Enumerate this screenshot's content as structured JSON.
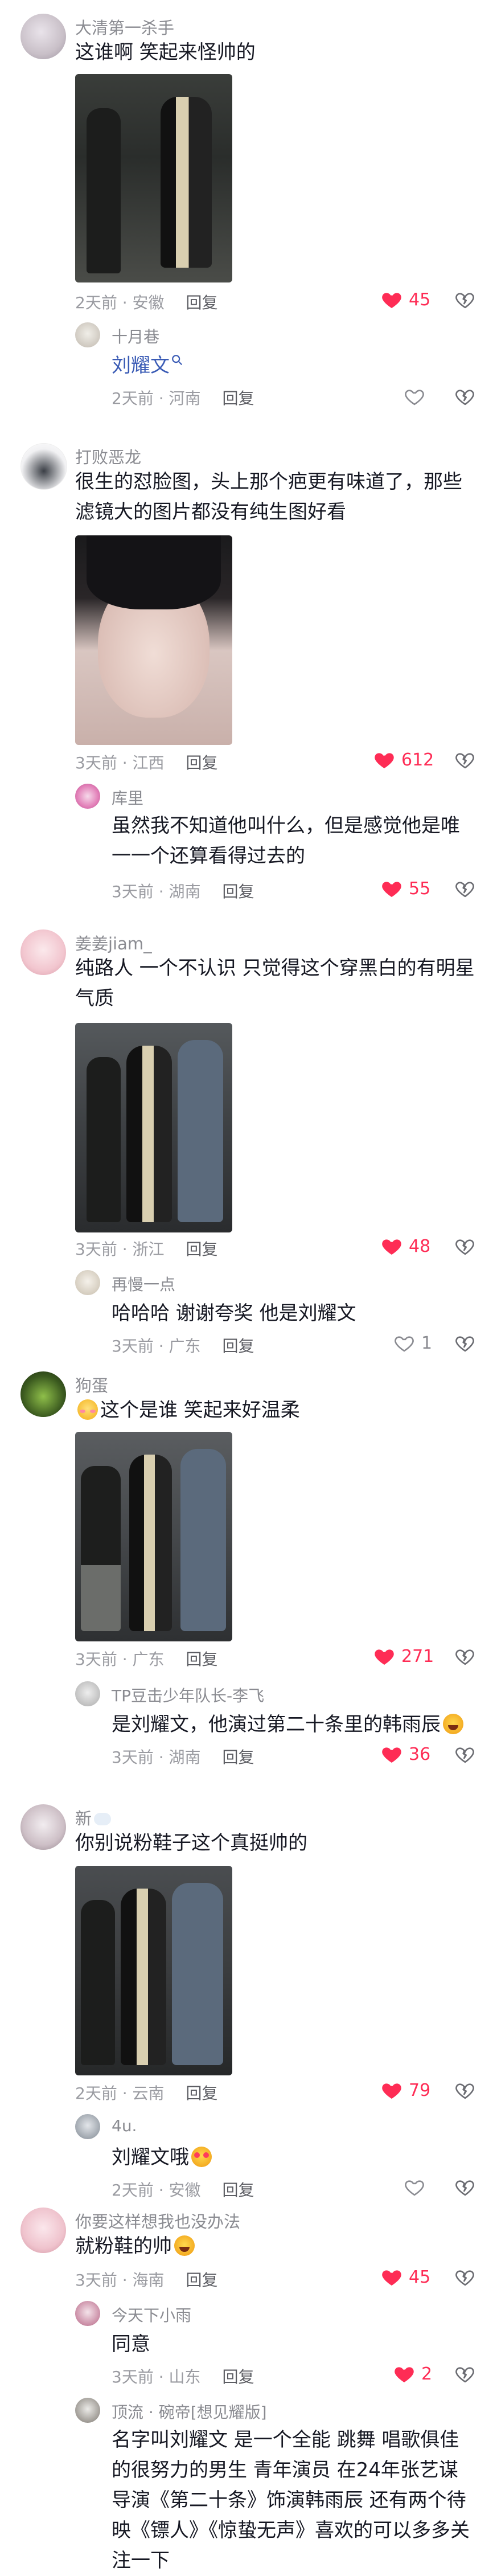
{
  "comments": [
    {
      "user": "大清第一杀手",
      "text": "这谁啊 笑起来怪帅的",
      "time": "2天前 · 安徽",
      "reply_label": "回复",
      "likes": "45",
      "replies": [
        {
          "user": "十月巷",
          "text": "刘耀文",
          "time": "2天前 · 河南",
          "reply_label": "回复",
          "likes": ""
        }
      ]
    },
    {
      "user": "打败恶龙",
      "text": "很生的怼脸图，头上那个疤更有味道了，那些滤镜大的图片都没有纯生图好看",
      "time": "3天前 · 江西",
      "reply_label": "回复",
      "likes": "612",
      "replies": [
        {
          "user": "库里",
          "text": "虽然我不知道他叫什么，但是感觉他是唯一一个还算看得过去的",
          "time": "3天前 · 湖南",
          "reply_label": "回复",
          "likes": "55"
        }
      ]
    },
    {
      "user": "姜姜jiam_",
      "text": "纯路人 一个不认识 只觉得这个穿黑白的有明星气质",
      "time": "3天前 · 浙江",
      "reply_label": "回复",
      "likes": "48",
      "replies": [
        {
          "user": "再慢一点",
          "text": "哈哈哈 谢谢夸奖 他是刘耀文",
          "time": "3天前 · 广东",
          "reply_label": "回复",
          "likes": "1"
        }
      ]
    },
    {
      "user": "狗蛋",
      "text": "这个是谁 笑起来好温柔",
      "time": "3天前 · 广东",
      "reply_label": "回复",
      "likes": "271",
      "replies": [
        {
          "user": "TP豆击少年队长-李飞",
          "text": "是刘耀文，他演过第二十条里的韩雨辰",
          "time": "3天前 · 湖南",
          "reply_label": "回复",
          "likes": "36"
        }
      ]
    },
    {
      "user": "新",
      "text": "你别说粉鞋子这个真挺帅的",
      "time": "2天前 · 云南",
      "reply_label": "回复",
      "likes": "79",
      "replies": [
        {
          "user": "4u.",
          "text": "刘耀文哦",
          "time": "2天前 · 安徽",
          "reply_label": "回复",
          "likes": ""
        }
      ]
    },
    {
      "user": "你要这样想我也没办法",
      "text": "就粉鞋的帅",
      "time": "3天前 · 海南",
      "reply_label": "回复",
      "likes": "45",
      "replies": [
        {
          "user": "今天下小雨",
          "text": "同意",
          "time": "3天前 · 山东",
          "reply_label": "回复",
          "likes": "2"
        },
        {
          "user": "顶流 · 碗帝[想见耀版]",
          "text": "名字叫刘耀文 是一个全能 跳舞 唱歌俱佳的很努力的男生  青年演员 在24年张艺谋导演《第二十条》饰演韩雨辰 还有两个待映《镖人》《惊蛰无声》喜欢的可以多多关注一下",
          "time": "",
          "reply_label": "",
          "likes": ""
        }
      ]
    }
  ],
  "icons": {
    "like": "heart-icon",
    "dislike": "broken-heart-icon",
    "search": "search-icon"
  },
  "colors": {
    "like_active": "#fe2c55",
    "link": "#3a5bb5",
    "meta": "#9a9ba1"
  }
}
